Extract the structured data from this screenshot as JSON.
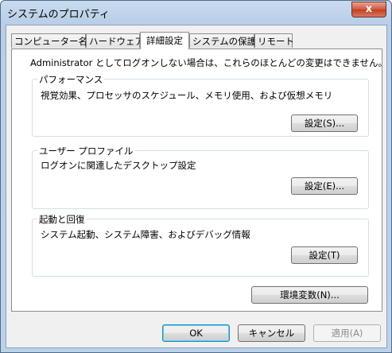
{
  "window": {
    "title": "システムのプロパティ",
    "close_glyph": "x"
  },
  "tabs": [
    {
      "label": "コンピューター名",
      "active": false
    },
    {
      "label": "ハードウェア",
      "active": false
    },
    {
      "label": "詳細設定",
      "active": true
    },
    {
      "label": "システムの保護",
      "active": false
    },
    {
      "label": "リモート",
      "active": false
    }
  ],
  "advanced": {
    "admin_note": "Administrator としてログオンしない場合は、これらのほとんどの変更はできません。",
    "performance": {
      "title": "パフォーマンス",
      "description": "視覚効果、プロセッサのスケジュール、メモリ使用、および仮想メモリ",
      "button": "設定(S)..."
    },
    "user_profiles": {
      "title": "ユーザー プロファイル",
      "description": "ログオンに関連したデスクトップ設定",
      "button": "設定(E)..."
    },
    "startup_recovery": {
      "title": "起動と回復",
      "description": "システム起動、システム障害、およびデバッグ情報",
      "button": "設定(T)"
    },
    "env_button": "環境変数(N)..."
  },
  "footer": {
    "ok": "OK",
    "cancel": "キャンセル",
    "apply": "適用(A)",
    "apply_enabled": false
  }
}
